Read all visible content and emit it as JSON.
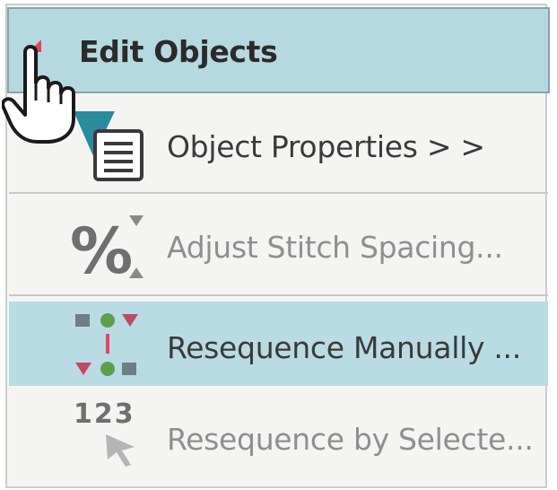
{
  "menu": {
    "header": {
      "title": "Edit Objects",
      "icon": "expand-triangle-icon",
      "marker_color": "#e0465a"
    },
    "items": [
      {
        "label": "Object Properties > >",
        "icon": "object-properties-icon",
        "enabled": true,
        "highlighted": false
      },
      {
        "label": "Adjust Stitch Spacing...",
        "icon": "percent-spacing-icon",
        "enabled": false,
        "highlighted": false
      },
      {
        "label": "Resequence Manually ...",
        "icon": "resequence-manual-icon",
        "enabled": true,
        "highlighted": true
      },
      {
        "label": "Resequence by Selecte...",
        "icon": "resequence-selection-icon",
        "enabled": false,
        "highlighted": false
      }
    ],
    "numbers_icon_text": "123"
  },
  "colors": {
    "header_bg": "#b6d8e1",
    "highlight_bg": "#b9dbe4",
    "panel_bg": "#f4f5f3",
    "accent_teal": "#2a8c9c",
    "accent_red": "#e0465a"
  },
  "cursor": {
    "icon": "hand-pointer-icon"
  }
}
